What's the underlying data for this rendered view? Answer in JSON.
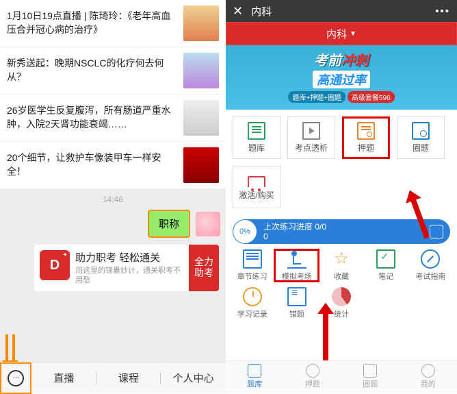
{
  "left": {
    "articles": [
      "1月10日19点直播 | 陈琦玲：《老年高血压合并冠心病的治疗》",
      "新秀送起：晚期NSCLC的化疗何去何从？",
      "26岁医学生反复腹泻，所有肠道严重水肿，入院2天肾功能衰竭……",
      "20个细节，让救护车像装甲车一样安全！"
    ],
    "timestamp": "14:46",
    "sent_message": "职称",
    "card": {
      "logo": "D",
      "title": "助力职考 轻松通关",
      "subtitle": "用这里的锦囊妙计，通关职考不用愁",
      "badge": "全力助考"
    },
    "tabs": [
      "直播",
      "课程",
      "个人中心"
    ]
  },
  "right": {
    "header_title": "内科",
    "subheader": "内科",
    "banner": {
      "line1a": "考前",
      "line1b": "冲刺",
      "line2": "高通过率",
      "pill1": "题库+押题+圈题",
      "pill2": "高级套餐596"
    },
    "grid": [
      "题库",
      "考点透析",
      "押题",
      "圈题",
      "激活/购买"
    ],
    "progress": {
      "pct": "0%",
      "label": "上次练习进度 0/0",
      "sub": "0"
    },
    "row1": [
      "章节练习",
      "模拟考场",
      "收藏",
      "笔记",
      "考试指南"
    ],
    "row2": [
      "学习记录",
      "错题",
      "统计"
    ],
    "tabs": [
      "题库",
      "押题",
      "圈题",
      "我的"
    ]
  }
}
